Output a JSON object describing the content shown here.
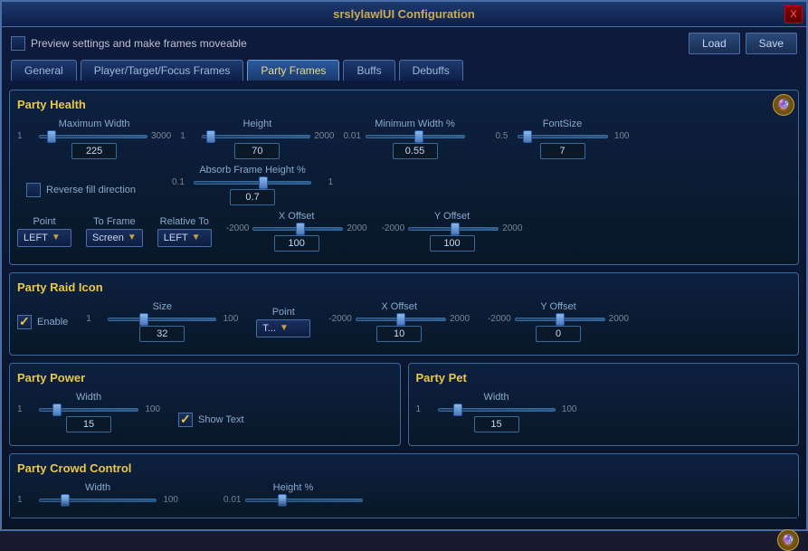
{
  "window": {
    "title": "srslylawlUI Configuration",
    "close_label": "X"
  },
  "top_bar": {
    "preview_label": "Preview settings and make frames moveable",
    "load_label": "Load",
    "save_label": "Save"
  },
  "tabs": [
    {
      "id": "general",
      "label": "General",
      "active": false
    },
    {
      "id": "player",
      "label": "Player/Target/Focus Frames",
      "active": false
    },
    {
      "id": "party",
      "label": "Party Frames",
      "active": true
    },
    {
      "id": "buffs",
      "label": "Buffs",
      "active": false
    },
    {
      "id": "debuffs",
      "label": "Debuffs",
      "active": false
    }
  ],
  "party_health": {
    "title": "Party Health",
    "max_width": {
      "label": "Maximum Width",
      "min": "1",
      "max": "3000",
      "value": "225",
      "range_val": 7
    },
    "height": {
      "label": "Height",
      "min": "1",
      "max": "2000",
      "value": "70",
      "range_val": 3
    },
    "min_width_pct": {
      "label": "Minimum Width %",
      "min": "0.01",
      "max": "",
      "value": "0.55",
      "range_val": 50
    },
    "font_size": {
      "label": "FontSize",
      "min": "0.5",
      "max": "100",
      "value": "7",
      "range_val": 6
    },
    "absorb_label": "Absorb Frame Height %",
    "absorb_min": "0.1",
    "absorb_max": "1",
    "absorb_value": "0.7",
    "absorb_range": 60,
    "reverse_fill": "Reverse fill direction",
    "point": {
      "label": "Point",
      "value": "LEFT"
    },
    "to_frame": {
      "label": "To Frame",
      "value": "Screen"
    },
    "relative_to": {
      "label": "Relative To",
      "value": "LEFT"
    },
    "x_offset": {
      "label": "X Offset",
      "min": "-2000",
      "max": "2000",
      "value": "100",
      "range_val": 52
    },
    "y_offset": {
      "label": "Y Offset",
      "min": "-2000",
      "max": "2000",
      "value": "100",
      "range_val": 52
    }
  },
  "party_raid_icon": {
    "title": "Party Raid Icon",
    "enable_label": "Enable",
    "size": {
      "label": "Size",
      "min": "1",
      "max": "100",
      "value": "32",
      "range_val": 32
    },
    "point": {
      "label": "Point",
      "value": "T..."
    },
    "x_offset": {
      "label": "X Offset",
      "min": "-2000",
      "max": "2000",
      "value": "10",
      "range_val": 50
    },
    "y_offset": {
      "label": "Y Offset",
      "min": "-2000",
      "max": "2000",
      "value": "0",
      "range_val": 50
    }
  },
  "party_power": {
    "title": "Party Power",
    "width": {
      "label": "Width",
      "min": "1",
      "max": "100",
      "value": "15",
      "range_val": 15
    },
    "show_text_label": "Show Text"
  },
  "party_pet": {
    "title": "Party Pet",
    "width": {
      "label": "Width",
      "min": "1",
      "max": "100",
      "value": "15",
      "range_val": 15
    }
  },
  "party_crowd_control": {
    "title": "Party Crowd Control",
    "width_label": "Width",
    "height_pct_label": "Height %"
  }
}
